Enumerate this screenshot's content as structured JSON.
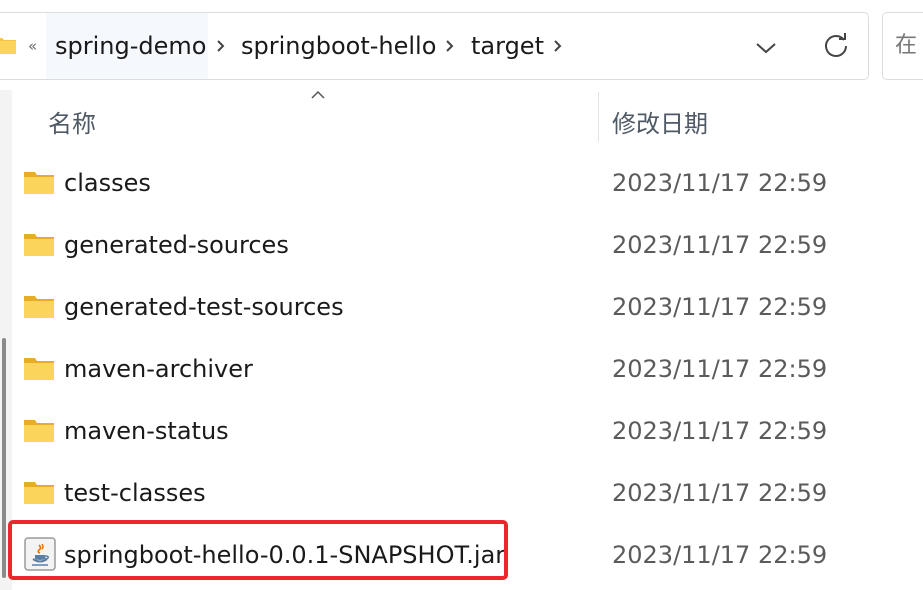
{
  "address_bar": {
    "overflow_symbol": "«",
    "breadcrumbs": [
      {
        "label": "spring-demo"
      },
      {
        "label": "springboot-hello"
      },
      {
        "label": "target"
      }
    ]
  },
  "search": {
    "placeholder": "在"
  },
  "columns": {
    "name": "名称",
    "date_modified": "修改日期"
  },
  "files": [
    {
      "name": "classes",
      "date": "2023/11/17 22:59",
      "type": "folder"
    },
    {
      "name": "generated-sources",
      "date": "2023/11/17 22:59",
      "type": "folder"
    },
    {
      "name": "generated-test-sources",
      "date": "2023/11/17 22:59",
      "type": "folder"
    },
    {
      "name": "maven-archiver",
      "date": "2023/11/17 22:59",
      "type": "folder"
    },
    {
      "name": "maven-status",
      "date": "2023/11/17 22:59",
      "type": "folder"
    },
    {
      "name": "test-classes",
      "date": "2023/11/17 22:59",
      "type": "folder"
    },
    {
      "name": "springboot-hello-0.0.1-SNAPSHOT.jar",
      "date": "2023/11/17 22:59",
      "type": "jar"
    }
  ],
  "colors": {
    "folder": "#f6c342",
    "highlight": "#e8282d"
  }
}
